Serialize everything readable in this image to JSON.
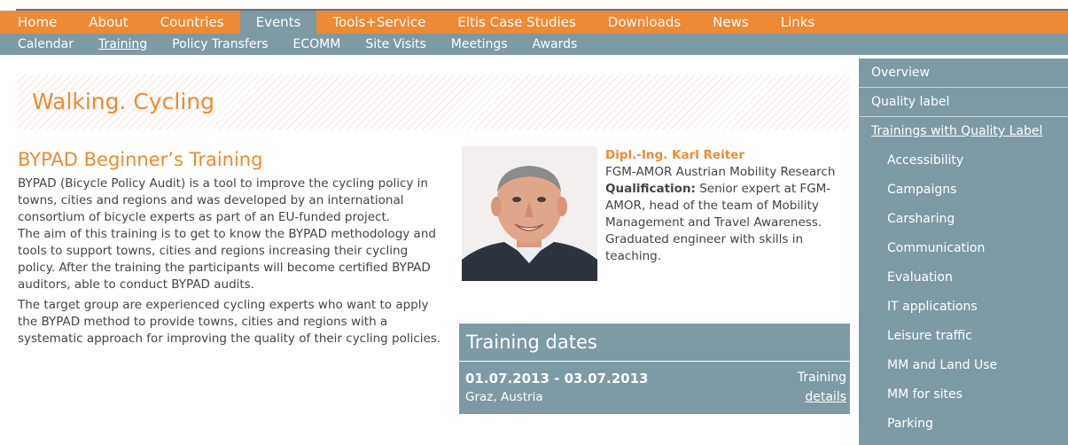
{
  "main_nav": [
    "Home",
    "About",
    "Countries",
    "Events",
    "Tools+Service",
    "Eltis Case Studies",
    "Downloads",
    "News",
    "Links"
  ],
  "sub_nav": [
    "Calendar",
    "Training",
    "Policy Transfers",
    "ECOMM",
    "Site Visits",
    "Meetings",
    "Awards"
  ],
  "page_title": "Walking. Cycling",
  "training": {
    "title": "BYPAD Beginner’s Training",
    "para1": "BYPAD (Bicycle Policy Audit) is a tool to improve the cycling policy in towns, cities and regions and was developed by an international consortium of bicycle experts as part of an EU-funded project.",
    "para2": "The aim of this training is to get to know the BYPAD methodology and tools to support towns, cities and regions increasing their cycling policy. After the training the participants will become certified BYPAD auditors, able to conduct BYPAD audits.",
    "para3": "The target group are experienced cycling experts who want to apply the BYPAD method to provide towns, cities and regions with a systematic approach for improving the quality of their cycling policies."
  },
  "expert": {
    "name": "Dipl.-Ing. Karl Reiter",
    "org": "FGM-AMOR Austrian Mobility Research",
    "qual_label": "Qualification:",
    "qual_text": " Senior expert at FGM-AMOR, head of the team of Mobility Management and Travel Awareness. Graduated engineer with skills in teaching."
  },
  "dates": {
    "heading": "Training dates",
    "date": "01.07.2013 - 03.07.2013",
    "place": "Graz, Austria",
    "link_line1": "Training",
    "link_line2": "details"
  },
  "sidebar": {
    "items": [
      "Overview",
      "Quality label",
      "Trainings with Quality Label"
    ],
    "sub_items": [
      "Accessibility",
      "Campaigns",
      "Carsharing",
      "Communication",
      "Evaluation",
      "IT applications",
      "Leisure traffic",
      "MM and Land Use",
      "MM for sites",
      "Parking"
    ]
  },
  "colors": {
    "accent": "#ee8a34",
    "nav_blue": "#7e9aa5"
  }
}
